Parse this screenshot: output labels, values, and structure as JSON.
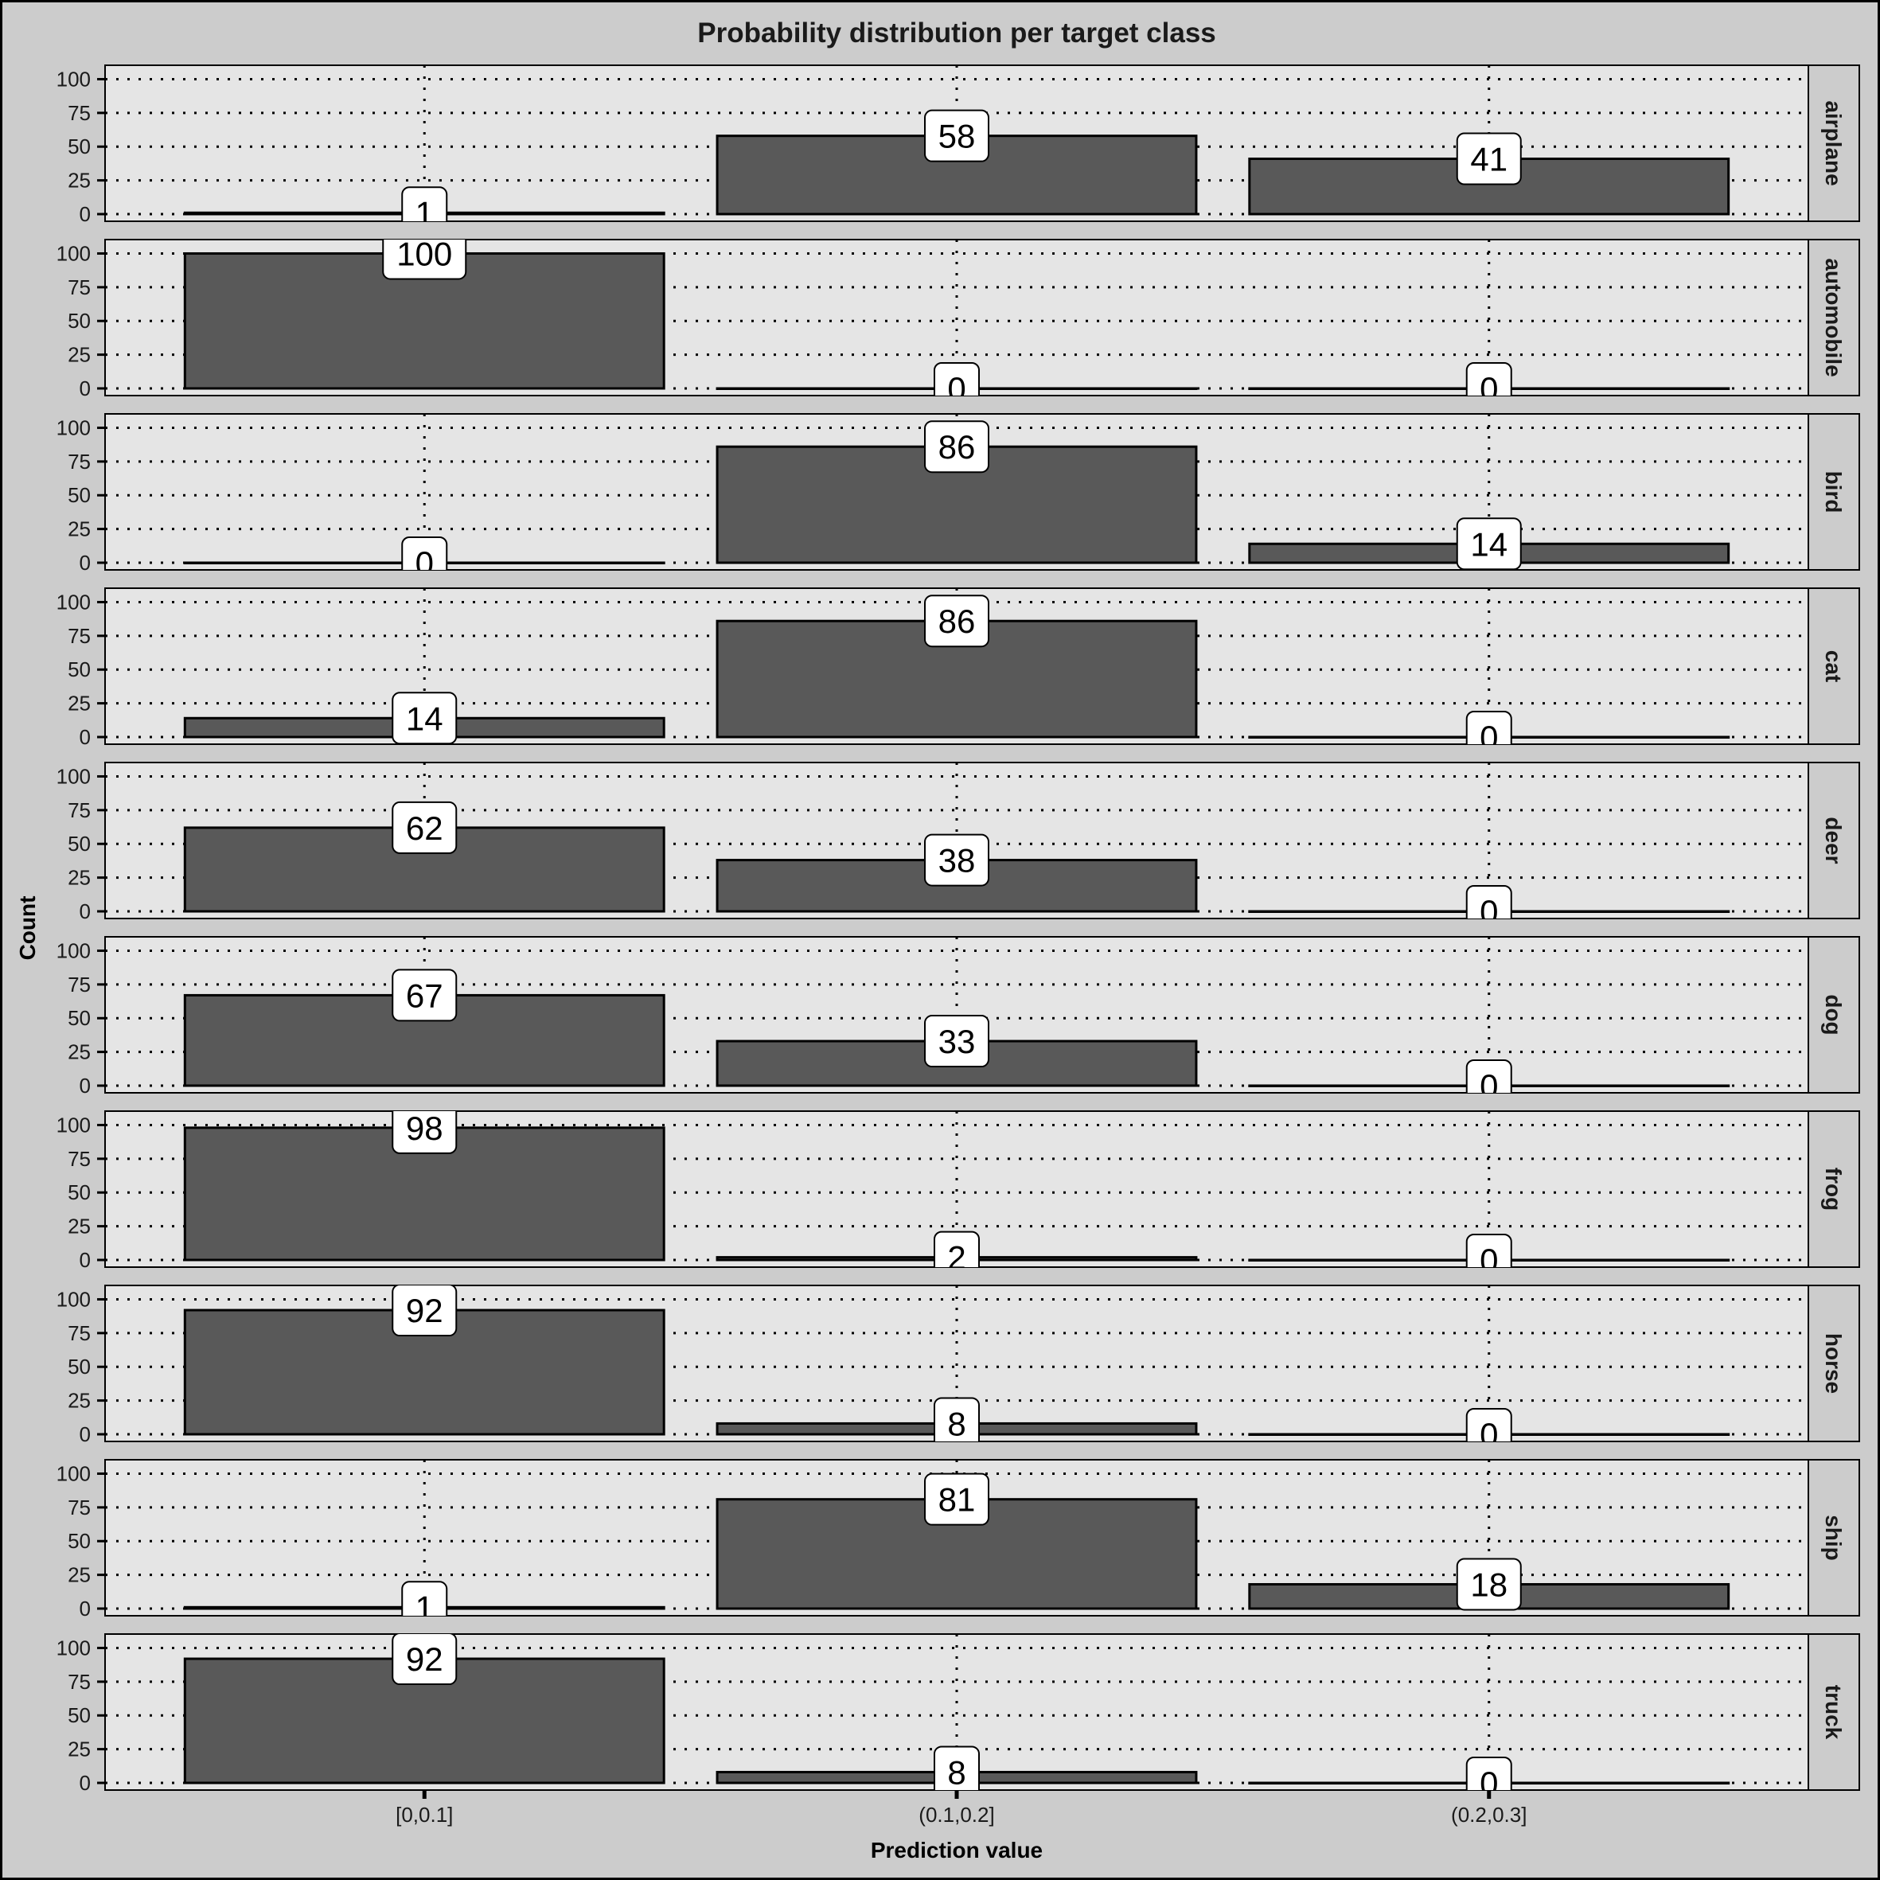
{
  "chart_data": {
    "type": "bar",
    "title": "Probability distribution per target class",
    "xlabel": "Prediction value",
    "ylabel": "Count",
    "categories": [
      "[0,0.1]",
      "(0.1,0.2]",
      "(0.2,0.3]"
    ],
    "y_ticks": [
      0,
      25,
      50,
      75,
      100
    ],
    "ylim": [
      0,
      105
    ],
    "grid": "dotted",
    "facets": [
      {
        "name": "airplane",
        "values": [
          1,
          58,
          41
        ]
      },
      {
        "name": "automobile",
        "values": [
          100,
          0,
          0
        ]
      },
      {
        "name": "bird",
        "values": [
          0,
          86,
          14
        ]
      },
      {
        "name": "cat",
        "values": [
          14,
          86,
          0
        ]
      },
      {
        "name": "deer",
        "values": [
          62,
          38,
          0
        ]
      },
      {
        "name": "dog",
        "values": [
          67,
          33,
          0
        ]
      },
      {
        "name": "frog",
        "values": [
          98,
          2,
          0
        ]
      },
      {
        "name": "horse",
        "values": [
          92,
          8,
          0
        ]
      },
      {
        "name": "ship",
        "values": [
          1,
          81,
          18
        ]
      },
      {
        "name": "truck",
        "values": [
          92,
          8,
          0
        ]
      }
    ],
    "colors": {
      "background": "#cccccc",
      "panel": "#e5e5e5",
      "strip": "#cccccc",
      "bar_fill": "#595959",
      "bar_stroke": "#000000",
      "grid": "#000000",
      "label_fill": "#ffffff"
    }
  }
}
